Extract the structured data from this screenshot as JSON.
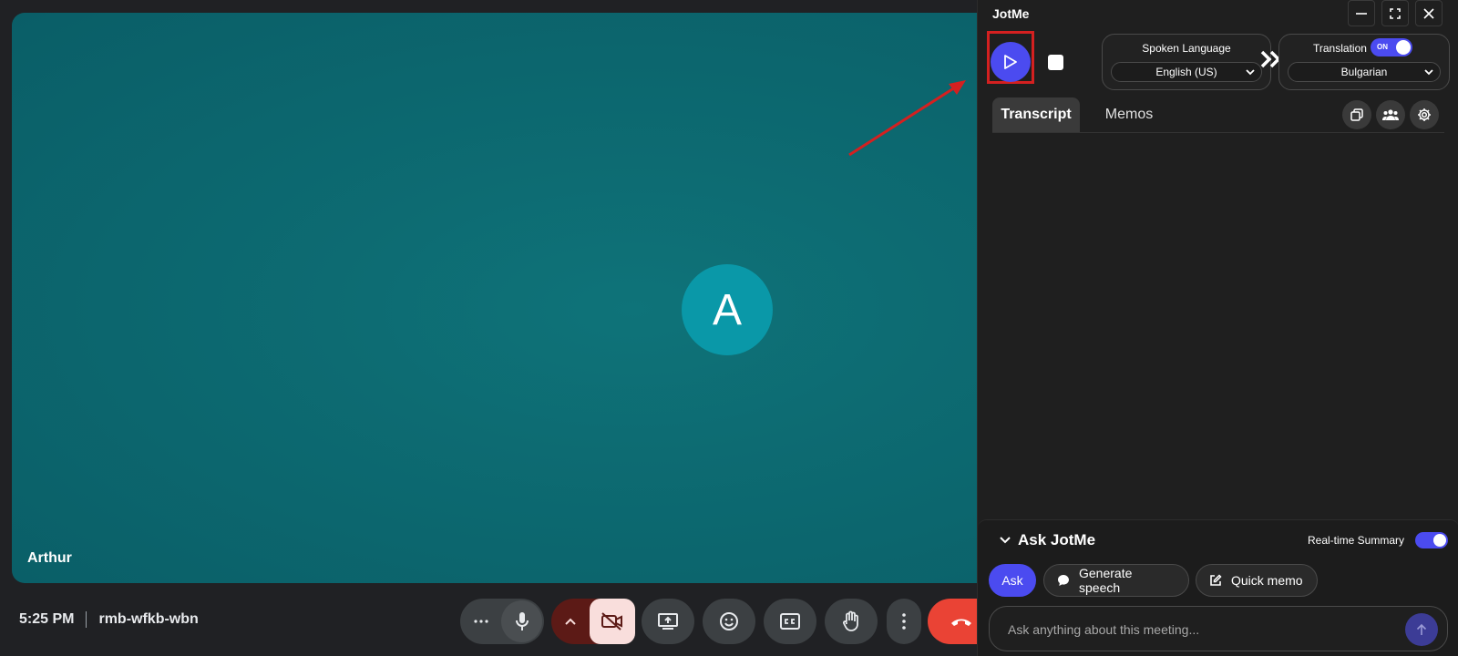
{
  "meet": {
    "participant_initial": "A",
    "participant_name": "Arthur",
    "time": "5:25 PM",
    "meeting_code": "rmb-wfkb-wbn"
  },
  "jotme": {
    "title": "JotMe",
    "spoken_language": {
      "label": "Spoken Language",
      "value": "English (US)"
    },
    "translation": {
      "label": "Translation",
      "toggle": "ON",
      "value": "Bulgarian"
    },
    "tabs": [
      {
        "label": "Transcript",
        "active": true
      },
      {
        "label": "Memos",
        "active": false
      }
    ],
    "ask": {
      "title": "Ask JotMe",
      "realtime_summary_label": "Real-time Summary",
      "realtime_summary_on": true,
      "chips": {
        "ask": "Ask",
        "generate_speech": "Generate speech",
        "quick_memo": "Quick memo"
      },
      "input_placeholder": "Ask anything about this meeting..."
    }
  },
  "colors": {
    "accent": "#4b4bf0",
    "tile": "#0d6b72",
    "avatar": "#0a98a8",
    "leave": "#ea4335",
    "highlight": "#d42020"
  },
  "icons": [
    "minimize-icon",
    "fullscreen-icon",
    "close-icon",
    "play-icon",
    "stop-icon",
    "chevron-down-icon",
    "double-chevron-right-icon",
    "copy-icon",
    "people-icon",
    "gear-icon",
    "chat-bubble-icon",
    "edit-icon",
    "arrow-up-icon",
    "more-horizontal-icon",
    "mic-icon",
    "caret-up-icon",
    "camera-off-icon",
    "present-screen-icon",
    "emoji-icon",
    "captions-icon",
    "raise-hand-icon",
    "more-vertical-icon",
    "hang-up-icon"
  ]
}
